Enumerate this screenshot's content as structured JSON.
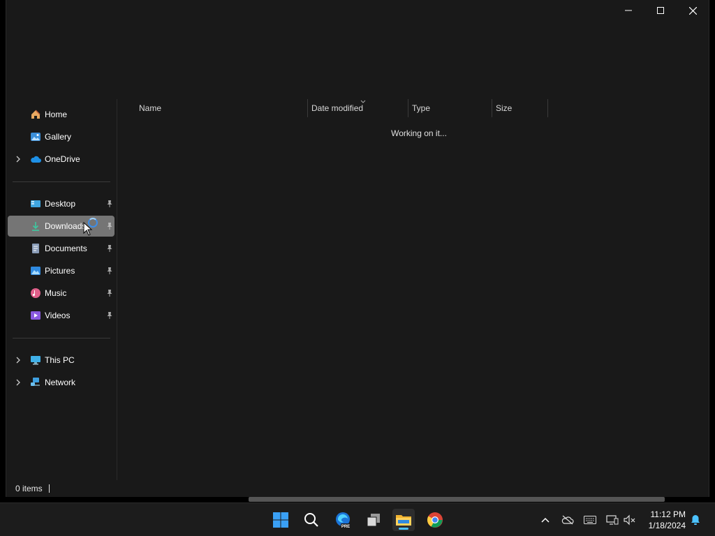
{
  "explorer": {
    "columns": [
      "Name",
      "Date modified",
      "Type",
      "Size"
    ],
    "status_message": "Working on it...",
    "item_count": "0 items",
    "nav": {
      "home": "Home",
      "gallery": "Gallery",
      "onedrive": "OneDrive",
      "desktop": "Desktop",
      "downloads": "Downloads",
      "documents": "Documents",
      "pictures": "Pictures",
      "music": "Music",
      "videos": "Videos",
      "this_pc": "This PC",
      "network": "Network"
    },
    "selected_nav": "Downloads",
    "pinned": [
      "Desktop",
      "Downloads",
      "Documents",
      "Pictures",
      "Music",
      "Videos"
    ]
  },
  "taskbar": {
    "apps": [
      "windows-start",
      "search",
      "edge-preview",
      "task-view",
      "file-explorer",
      "chrome"
    ],
    "active_app": "file-explorer",
    "edge_badge": "PRE",
    "clock": {
      "time": "11:12 PM",
      "date": "1/18/2024"
    }
  },
  "colors": {
    "window_bg": "#191919",
    "selected_bg": "#757575",
    "accent": "#4cc2ff",
    "taskbar_bg": "#1c1c1c"
  }
}
